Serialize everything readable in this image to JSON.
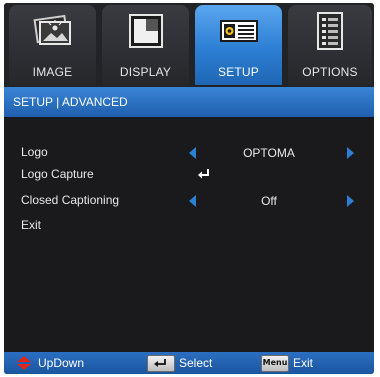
{
  "tabs": [
    {
      "label": "IMAGE",
      "icon": "image-icon"
    },
    {
      "label": "DISPLAY",
      "icon": "display-icon"
    },
    {
      "label": "SETUP",
      "icon": "projector-icon",
      "active": true
    },
    {
      "label": "OPTIONS",
      "icon": "options-list-icon"
    }
  ],
  "breadcrumb": "SETUP | ADVANCED",
  "menu": {
    "logo": {
      "label": "Logo",
      "value": "OPTOMA"
    },
    "logo_capture": {
      "label": "Logo Capture",
      "icon": "enter-icon"
    },
    "closed_captioning": {
      "label": "Closed Captioning",
      "value": "Off"
    },
    "exit": {
      "label": "Exit"
    }
  },
  "footer": {
    "updown": "UpDown",
    "select": "Select",
    "menu_key": "Menu",
    "exit": "Exit"
  },
  "colors": {
    "accent": "#2d7fd6",
    "active_tab": "#3d8fe0",
    "background": "#1b1b1d",
    "updown_arrow": "#e0251b"
  }
}
